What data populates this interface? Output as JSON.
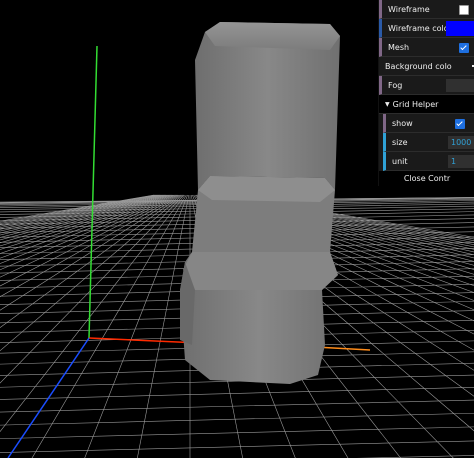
{
  "gui": {
    "wireframe": {
      "label": "Wireframe",
      "checked": false
    },
    "wireframe_color": {
      "label": "Wireframe color",
      "value": "#0000ff"
    },
    "mesh": {
      "label": "Mesh",
      "checked": true
    },
    "background_color": {
      "label": "Background colo"
    },
    "fog": {
      "label": "Fog"
    },
    "grid_helper": {
      "title": "Grid Helper",
      "show": {
        "label": "show",
        "checked": true
      },
      "size": {
        "label": "size",
        "value": "1000"
      },
      "unit": {
        "label": "unit",
        "value": "1"
      }
    },
    "close_label": "Close Contr"
  },
  "scene": {
    "background": "#000000",
    "grid_color": "#9a9a9a",
    "axis_colors": {
      "x": "#ff2a00",
      "y": "#33dd33",
      "z": "#1a4dff",
      "x_far": "#ff8c1a"
    },
    "model_color": "#7a7a7a"
  }
}
